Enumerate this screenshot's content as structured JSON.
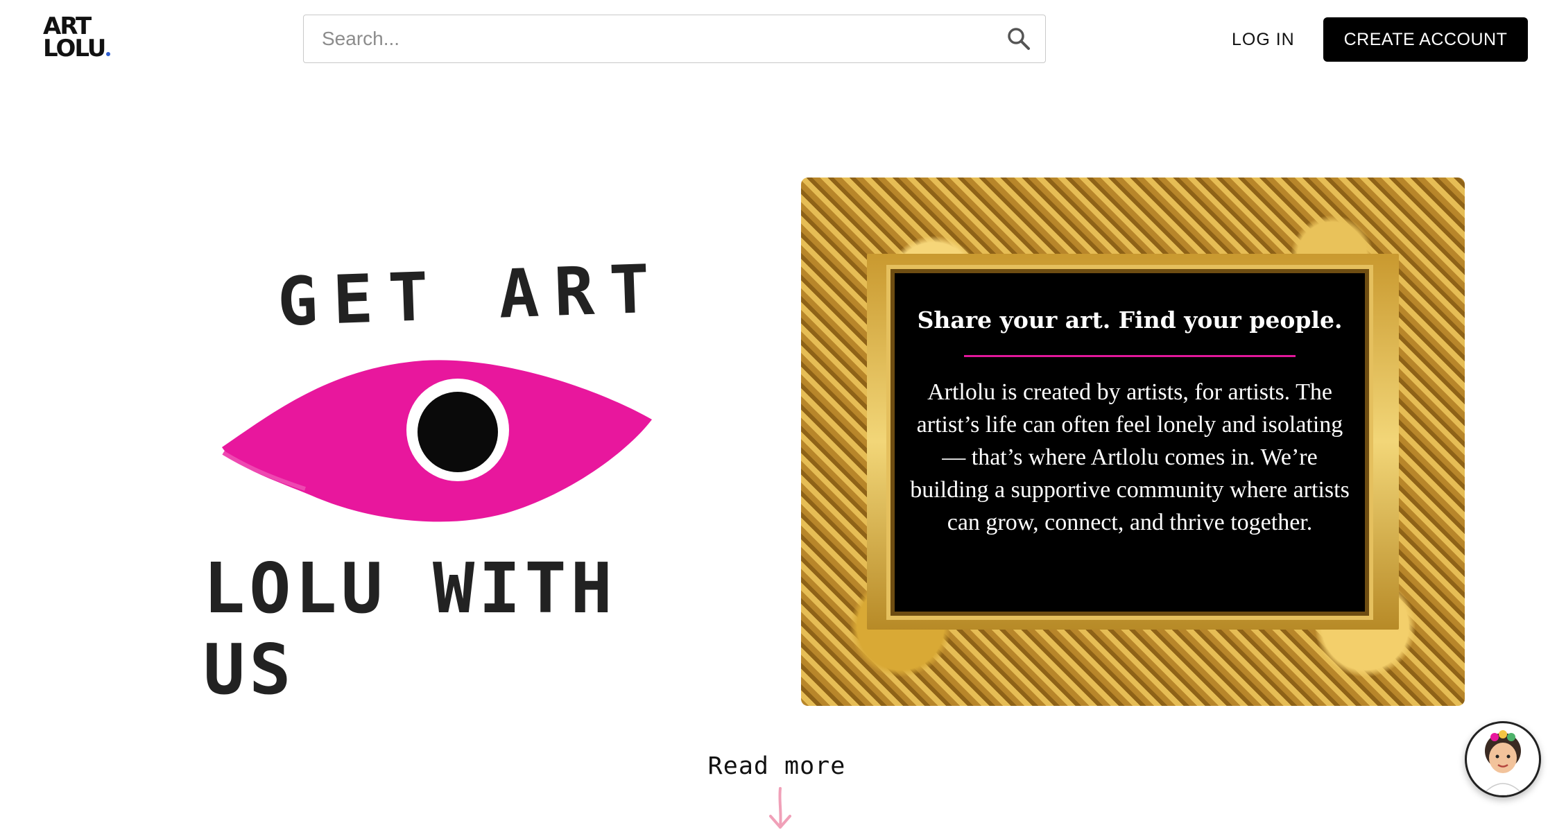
{
  "header": {
    "logo": {
      "line1": "ART",
      "line2": "LOLU"
    },
    "search": {
      "placeholder": "Search...",
      "icon": "search-icon"
    },
    "login_label": "LOG IN",
    "create_account_label": "CREATE ACCOUNT"
  },
  "hero": {
    "left": {
      "top_text": "GET ART",
      "bottom_text": "LOLU WITH US",
      "eye_color": "#e8179d"
    },
    "right": {
      "title": "Share your art. Find your people.",
      "body": "Artlolu is created by artists, for artists. The artist’s life can often feel lonely and isolating — that’s where Artlolu comes in. We’re building a supportive community where artists can grow, connect, and thrive together.",
      "rule_color": "#e0179a"
    }
  },
  "read_more": {
    "label": "Read more",
    "arrow_icon": "arrow-down-icon",
    "arrow_color": "#f0a0b8"
  },
  "chat_avatar": {
    "icon": "assistant-avatar-icon"
  },
  "colors": {
    "primary_button": "#000000",
    "accent_pink": "#e8179d",
    "logo_dot": "#2f5fd0"
  }
}
